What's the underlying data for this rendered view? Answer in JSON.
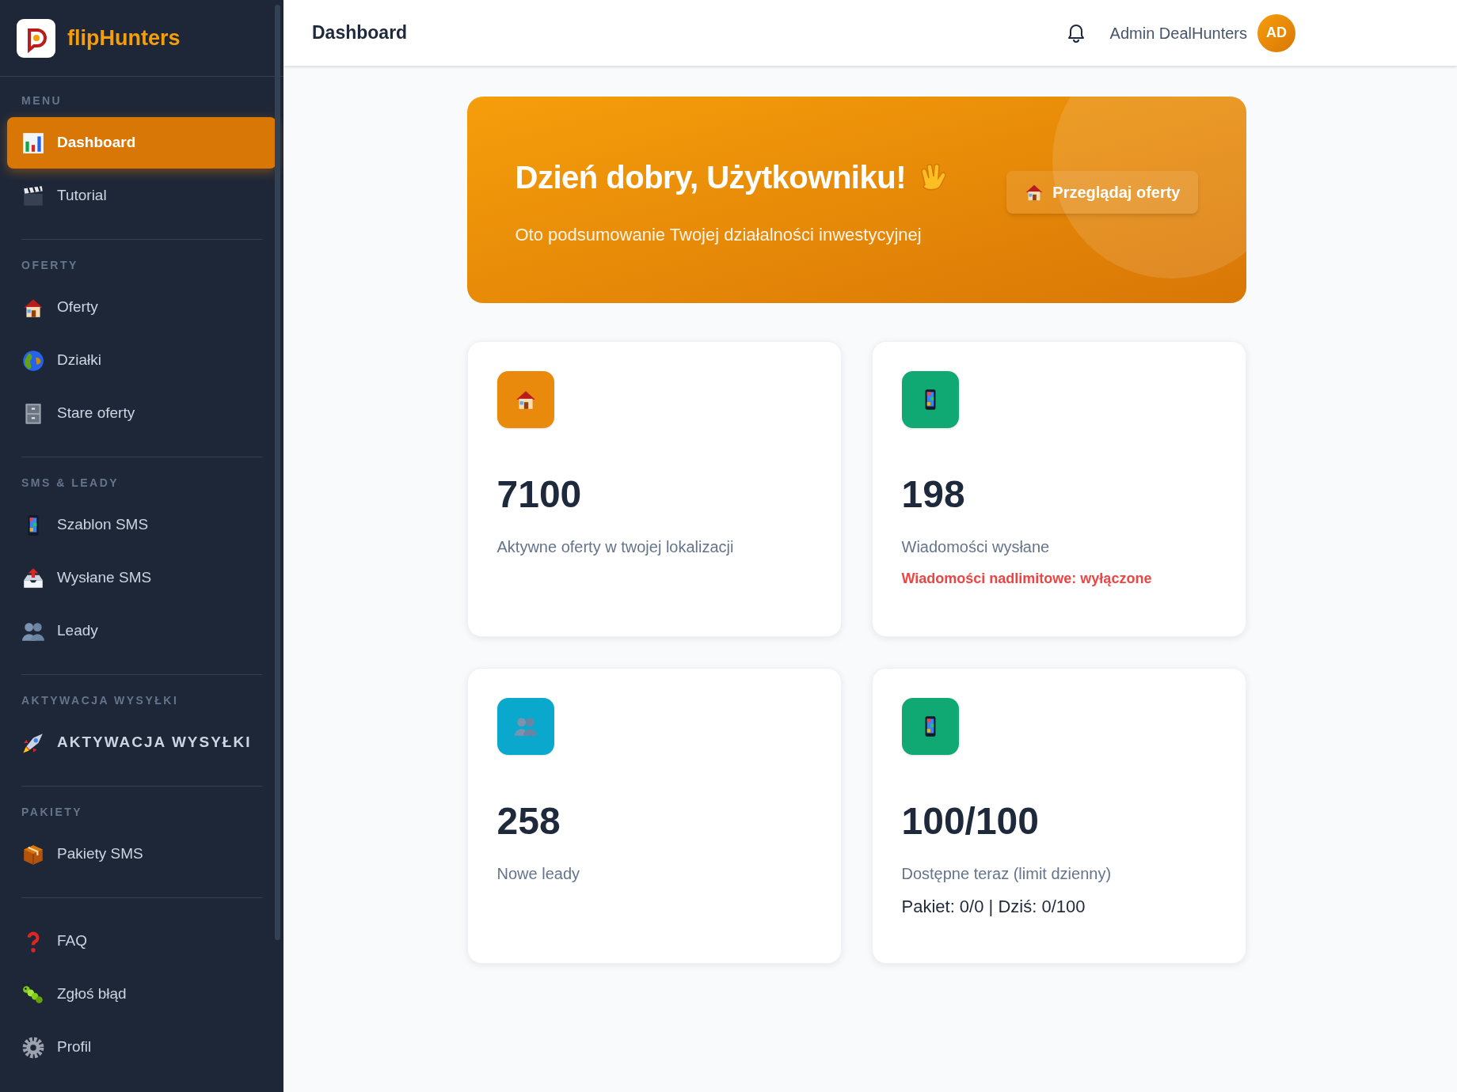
{
  "brand": {
    "name": "flipHunters"
  },
  "sidebar": {
    "sections": [
      {
        "title": "MENU",
        "items": [
          {
            "label": "Dashboard",
            "selected": true,
            "kind": "normal"
          },
          {
            "label": "Tutorial",
            "selected": false,
            "kind": "normal"
          }
        ]
      },
      {
        "title": "OFERTY",
        "items": [
          {
            "label": "Oferty",
            "selected": false,
            "kind": "normal"
          },
          {
            "label": "Działki",
            "selected": false,
            "kind": "normal"
          },
          {
            "label": "Stare oferty",
            "selected": false,
            "kind": "normal"
          }
        ]
      },
      {
        "title": "SMS & LEADY",
        "items": [
          {
            "label": "Szablon SMS",
            "selected": false,
            "kind": "normal"
          },
          {
            "label": "Wysłane SMS",
            "selected": false,
            "kind": "normal"
          },
          {
            "label": "Leady",
            "selected": false,
            "kind": "normal"
          }
        ]
      },
      {
        "title": "AKTYWACJA WYSYŁKI",
        "items": [
          {
            "label": "AKTYWACJA WYSYŁKI",
            "selected": false,
            "kind": "emphasis"
          }
        ]
      },
      {
        "title": "PAKIETY",
        "items": [
          {
            "label": "Pakiety SMS",
            "selected": false,
            "kind": "normal"
          }
        ]
      },
      {
        "items": [
          {
            "label": "FAQ",
            "selected": false,
            "kind": "normal"
          },
          {
            "label": "Zgłoś błąd",
            "selected": false,
            "kind": "normal"
          },
          {
            "label": "Profil",
            "selected": false,
            "kind": "normal"
          }
        ]
      }
    ]
  },
  "header": {
    "title": "Dashboard",
    "user_name": "Admin DealHunters",
    "avatar_initials": "AD"
  },
  "banner": {
    "title": "Dzień dobry, Użytkowniku!",
    "subtitle": "Oto podsumowanie Twojej działalności inwestycyjnej",
    "button": "Przeglądaj oferty"
  },
  "stats": [
    {
      "value": "7100",
      "label": "Aktywne oferty w twojej lokalizacji",
      "color": "#ea8a0c"
    },
    {
      "value": "198",
      "label": "Wiadomości wysłane",
      "color": "#10a873",
      "notes": [
        {
          "text": "Wiadomości nadlimitowe: wyłączone",
          "kind": "warning"
        }
      ]
    },
    {
      "value": "258",
      "label": "Nowe leady",
      "color": "#0aa8cc"
    },
    {
      "value": "100/100",
      "label": "Dostępne teraz (limit dzienny)",
      "color": "#10a873",
      "notes": [
        {
          "text": "Pakiet: 0/0 | Dziś: 0/100",
          "kind": "detail"
        }
      ]
    }
  ]
}
